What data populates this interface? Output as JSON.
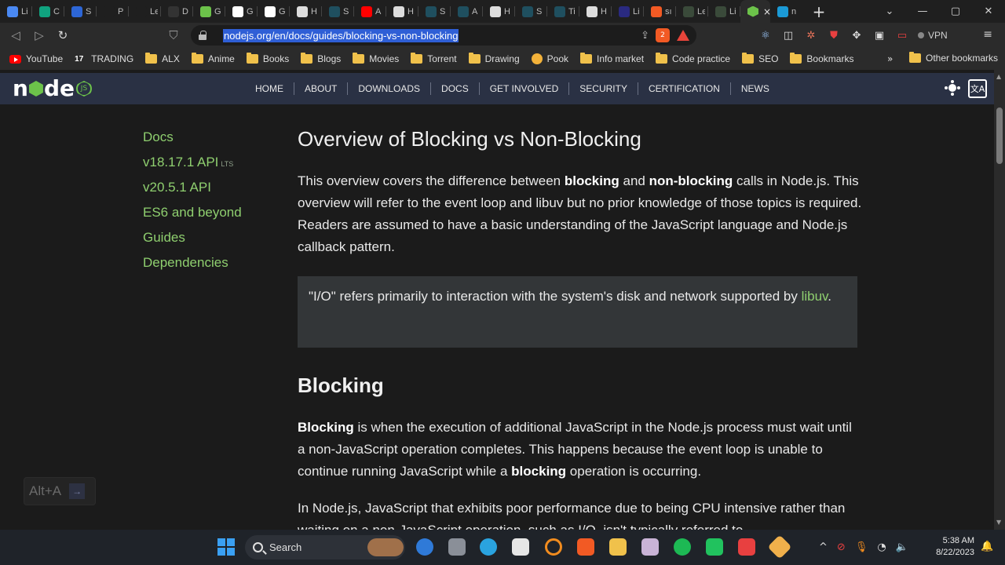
{
  "browser": {
    "tabs": [
      {
        "title": "Li",
        "color": "#4a89f3"
      },
      {
        "title": "C",
        "color": "#10a37f"
      },
      {
        "title": "S",
        "color": "#2d66d6"
      },
      {
        "title": "P",
        "color": "#1f1f1f"
      },
      {
        "title": "Le",
        "color": "#1f1f1f"
      },
      {
        "title": "D",
        "color": "#333"
      },
      {
        "title": "G",
        "color": "#6cc24a"
      },
      {
        "title": "G",
        "color": "#ffffff"
      },
      {
        "title": "G",
        "color": "#ffffff"
      },
      {
        "title": "H",
        "color": "#dddddd"
      },
      {
        "title": "S",
        "color": "#1f4f5f"
      },
      {
        "title": "A",
        "color": "#ff0000"
      },
      {
        "title": "H",
        "color": "#dddddd"
      },
      {
        "title": "S",
        "color": "#1f4f5f"
      },
      {
        "title": "A",
        "color": "#1f4f5f"
      },
      {
        "title": "H",
        "color": "#dddddd"
      },
      {
        "title": "S",
        "color": "#1f4f5f"
      },
      {
        "title": "Ti",
        "color": "#1f4f5f"
      },
      {
        "title": "H",
        "color": "#dddddd"
      },
      {
        "title": "Li",
        "color": "#2a2a80"
      },
      {
        "title": "sı",
        "color": "#f25a24"
      },
      {
        "title": "Le",
        "color": "#3a4a3a"
      },
      {
        "title": "Li",
        "color": "#3a4a3a"
      }
    ],
    "active_tab_color": "#6cc24a",
    "active_tab_close": "×",
    "last_tab": {
      "title": "n",
      "color": "#1b9ad6"
    },
    "new_tab": "+",
    "window_controls": {
      "dropdown": "⌄",
      "minimize": "—",
      "maximize": "▢",
      "close": "✕"
    },
    "nav": {
      "back": "◁",
      "forward": "▷",
      "reload": "↻",
      "bookmark": "⛉"
    },
    "url": "nodejs.org/en/docs/guides/blocking-vs-non-blocking",
    "brave_badge": "2",
    "vpn_label": "VPN",
    "menu_icon": "≡"
  },
  "bookmarks": [
    {
      "label": "YouTube",
      "icon": "youtube-icon"
    },
    {
      "label": "TRADING",
      "icon": "tradingview-icon"
    },
    {
      "label": "ALX",
      "icon": "folder-icon"
    },
    {
      "label": "Anime",
      "icon": "folder-icon"
    },
    {
      "label": "Books",
      "icon": "folder-icon"
    },
    {
      "label": "Blogs",
      "icon": "folder-icon"
    },
    {
      "label": "Movies",
      "icon": "folder-icon"
    },
    {
      "label": "Torrent",
      "icon": "folder-icon"
    },
    {
      "label": "Drawing",
      "icon": "folder-icon"
    },
    {
      "label": "Pook",
      "icon": "pook-icon"
    },
    {
      "label": "Info market",
      "icon": "folder-icon"
    },
    {
      "label": "Code practice",
      "icon": "folder-icon"
    },
    {
      "label": "SEO",
      "icon": "folder-icon"
    },
    {
      "label": "Bookmarks",
      "icon": "folder-icon"
    }
  ],
  "bookmarks_more": "»",
  "other_bookmarks": "Other bookmarks",
  "site": {
    "nav": [
      "HOME",
      "ABOUT",
      "DOWNLOADS",
      "DOCS",
      "GET INVOLVED",
      "SECURITY",
      "CERTIFICATION",
      "NEWS"
    ],
    "lang_icon": "文A",
    "sidebar": [
      {
        "label": "Docs",
        "badge": ""
      },
      {
        "label": "v18.17.1 API",
        "badge": "LTS"
      },
      {
        "label": "v20.5.1 API",
        "badge": ""
      },
      {
        "label": "ES6 and beyond",
        "badge": ""
      },
      {
        "label": "Guides",
        "badge": ""
      },
      {
        "label": "Dependencies",
        "badge": ""
      }
    ],
    "title": "Overview of Blocking vs Non-Blocking",
    "intro": {
      "a": "This overview covers the difference between ",
      "b1": "blocking",
      "c": " and ",
      "b2": "non-blocking",
      "d": " calls in Node.js. This overview will refer to the event loop and libuv but no prior knowledge of those topics is required. Readers are assumed to have a basic understanding of the JavaScript language and Node.js callback pattern."
    },
    "quote": {
      "text": "\"I/O\" refers primarily to interaction with the system's disk and network supported by ",
      "link": "libuv",
      "end": "."
    },
    "h2": "Blocking",
    "blocking_p": {
      "b1": "Blocking",
      "a": " is when the execution of additional JavaScript in the Node.js process must wait until a non-JavaScript operation completes. This happens because the event loop is unable to continue running JavaScript while a ",
      "b2": "blocking",
      "c": " operation is occurring."
    },
    "p3": "In Node.js, JavaScript that exhibits poor performance due to being CPU intensive rather than waiting on a non-JavaScript operation, such as I/O, isn't typically referred to"
  },
  "overlay": {
    "label": "Alt+A",
    "arrow": "→"
  },
  "taskbar": {
    "search": "Search",
    "time": "5:38 AM",
    "date": "8/22/2023",
    "tray_up": "^"
  }
}
